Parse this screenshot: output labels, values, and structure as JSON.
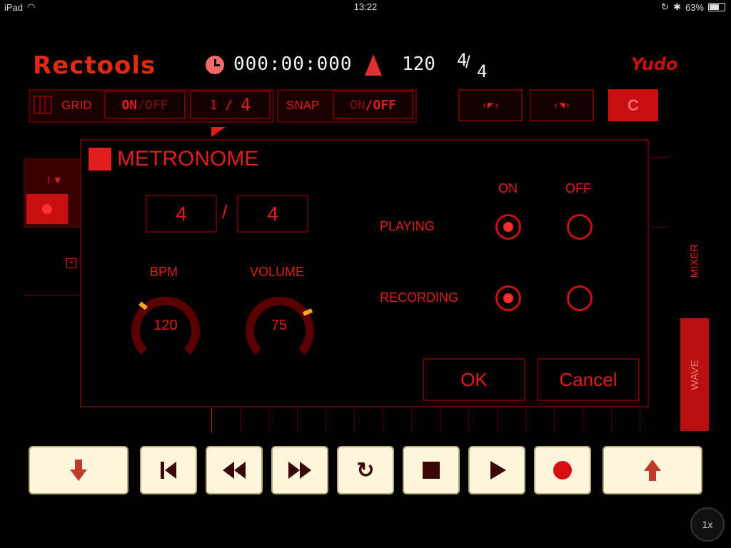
{
  "status_bar": {
    "device": "iPad",
    "time": "13:22",
    "battery": "63%"
  },
  "header": {
    "logo": "Rectools",
    "timecode": "000:00:000",
    "tempo": "120",
    "sig_top": "4",
    "sig_bottom": "4",
    "brand": "Yudo"
  },
  "toolbar": {
    "grid_label": "GRID",
    "grid_on": "ON",
    "grid_slash": "/",
    "grid_off": "OFF",
    "grid_value_num": "1",
    "grid_value_slash": "/",
    "grid_value_den": "4",
    "snap_label": "SNAP",
    "snap_on": "ON",
    "snap_slash": "/",
    "snap_off": "OFF",
    "c_label": "C"
  },
  "side_tabs": {
    "mixer": "MIXER",
    "wave": "WAVE"
  },
  "dialog": {
    "title": "METRONOME",
    "sig_numerator": "4",
    "sig_slash": "/",
    "sig_denominator": "4",
    "bpm_label": "BPM",
    "bpm_value": "120",
    "volume_label": "VOLUME",
    "volume_value": "75",
    "on_label": "ON",
    "off_label": "OFF",
    "playing_label": "PLAYING",
    "recording_label": "RECORDING",
    "playing_selected": "on",
    "recording_selected": "on",
    "ok_label": "OK",
    "cancel_label": "Cancel"
  },
  "transport": {
    "speed": "1x"
  },
  "colors": {
    "accent": "#e21d1d",
    "dark_red": "#5a0000",
    "button_face": "#fdf6dd",
    "knob_indicator": "#f5a623"
  }
}
